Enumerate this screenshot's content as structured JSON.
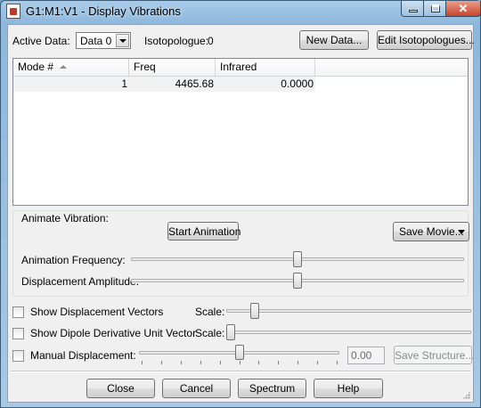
{
  "window": {
    "title": "G1:M1:V1 - Display Vibrations",
    "close_glyph": "✕"
  },
  "top": {
    "active_data_label": "Active Data:",
    "active_data_value": "Data 0",
    "isotopologue_label": "Isotopologue:",
    "isotopologue_value": "0",
    "new_data_button": "New Data...",
    "edit_isotopologues_button": "Edit Isotopologues..."
  },
  "table": {
    "columns": [
      "Mode #",
      "Freq",
      "Infrared"
    ],
    "rows": [
      {
        "mode": "1",
        "freq": "4465.68",
        "infrared": "0.0000"
      }
    ]
  },
  "animate": {
    "group_label": "Animate Vibration:",
    "start_button": "Start Animation",
    "save_movie_button": "Save Movie...",
    "frequency_label": "Animation Frequency:",
    "frequency_level": 0.5,
    "amplitude_label": "Displacement Amplitude:",
    "amplitude_level": 0.5
  },
  "options": {
    "show_vectors_label": "Show Displacement Vectors",
    "show_vectors_checked": false,
    "vectors_scale_label": "Scale:",
    "vectors_scale_level": 0.1,
    "show_dipole_label": "Show Dipole Derivative Unit Vector",
    "show_dipole_checked": false,
    "dipole_scale_label": "Scale:",
    "dipole_scale_level": 0.0,
    "manual_label": "Manual Displacement:",
    "manual_checked": false,
    "manual_value": "0.00",
    "manual_level": 0.5,
    "save_structure_button": "Save Structure..."
  },
  "bottom": {
    "close_button": "Close",
    "cancel_button": "Cancel",
    "spectrum_button": "Spectrum",
    "help_button": "Help"
  }
}
